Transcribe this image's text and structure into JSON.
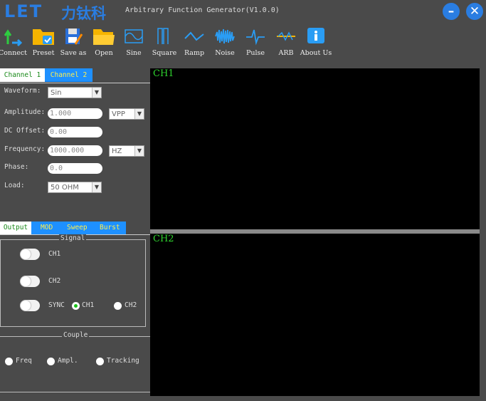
{
  "app": {
    "logo": "LET",
    "logo_cn": "力钛科",
    "title": "Arbitrary Function Generator(V1.0.0)",
    "minimize_icon": "minus-icon",
    "close_icon": "close-icon"
  },
  "toolbar": [
    {
      "label": "Connect",
      "icon": "connect-icon"
    },
    {
      "label": "Preset",
      "icon": "folder-check-icon"
    },
    {
      "label": "Save as",
      "icon": "save-icon"
    },
    {
      "label": "Open",
      "icon": "folder-icon"
    },
    {
      "label": "Sine",
      "icon": "sine-wave-icon"
    },
    {
      "label": "Square",
      "icon": "square-wave-icon"
    },
    {
      "label": "Ramp",
      "icon": "ramp-wave-icon"
    },
    {
      "label": "Noise",
      "icon": "noise-wave-icon"
    },
    {
      "label": "Pulse",
      "icon": "pulse-wave-icon"
    },
    {
      "label": "ARB",
      "icon": "arb-wave-icon"
    },
    {
      "label": "About Us",
      "icon": "info-icon"
    }
  ],
  "channel_tabs": [
    "Channel 1",
    "Channel 2"
  ],
  "params": {
    "waveform_label": "Waveform:",
    "waveform_value": "Sin",
    "amplitude_label": "Amplitude:",
    "amplitude_value": "1.000",
    "amplitude_unit": "VPP",
    "offset_label": "DC Offset:",
    "offset_value": "0.00",
    "frequency_label": "Frequency:",
    "frequency_value": "1000.000",
    "frequency_unit": "HZ",
    "phase_label": "Phase:",
    "phase_value": "0.0",
    "load_label": "Load:",
    "load_value": "50 OHM"
  },
  "mode_tabs": {
    "output": "Output",
    "mod": "MOD",
    "sweep": "Sweep",
    "burst": "Burst"
  },
  "signal": {
    "title": "Signal",
    "ch1": "CH1",
    "ch2": "CH2",
    "sync": "SYNC",
    "sync_ch1": "CH1",
    "sync_ch2": "CH2",
    "sync_selected": "CH1"
  },
  "couple": {
    "title": "Couple",
    "freq": "Freq",
    "ampl": "Ampl.",
    "tracking": "Tracking"
  },
  "displays": {
    "ch1": "CH1",
    "ch2": "CH2"
  },
  "colors": {
    "accent": "#1e90ff",
    "trace": "#2ed12e",
    "tab_text": "#ffef4d"
  }
}
